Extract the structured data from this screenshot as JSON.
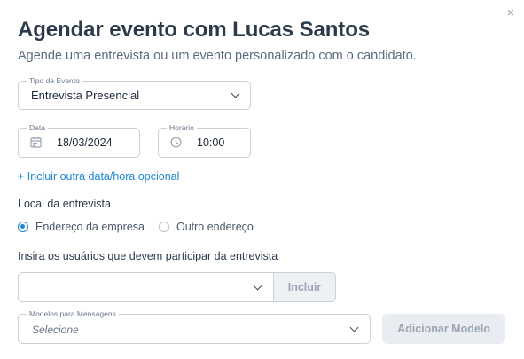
{
  "dialog": {
    "close_glyph": "×",
    "title": "Agendar evento com Lucas Santos",
    "subtitle": "Agende uma entrevista ou um evento personalizado com o candidato."
  },
  "tipo_evento": {
    "label": "Tipo de Evento",
    "value": "Entrevista Presencial"
  },
  "data": {
    "label": "Data",
    "value": "18/03/2024",
    "icon": "calendar-icon"
  },
  "horario": {
    "label": "Horário",
    "value": "10:00",
    "icon": "clock-icon"
  },
  "add_datetime_link": "+ Incluir outra data/hora opcional",
  "local": {
    "label": "Local da entrevista",
    "options": [
      {
        "label": "Endereço da empresa",
        "selected": true
      },
      {
        "label": "Outro endereço",
        "selected": false
      }
    ]
  },
  "usuarios": {
    "label": "Insira os usuários que devem participar da entrevista",
    "value": "",
    "button": "Incluir"
  },
  "modelos": {
    "label": "Modelos para Mensagens",
    "placeholder": "Selecione",
    "button": "Adicionar Modelo"
  },
  "colors": {
    "accent": "#1e88d0",
    "title": "#2c3a4b",
    "border": "#c9d0d9",
    "disabled_bg": "#e9edf1"
  }
}
